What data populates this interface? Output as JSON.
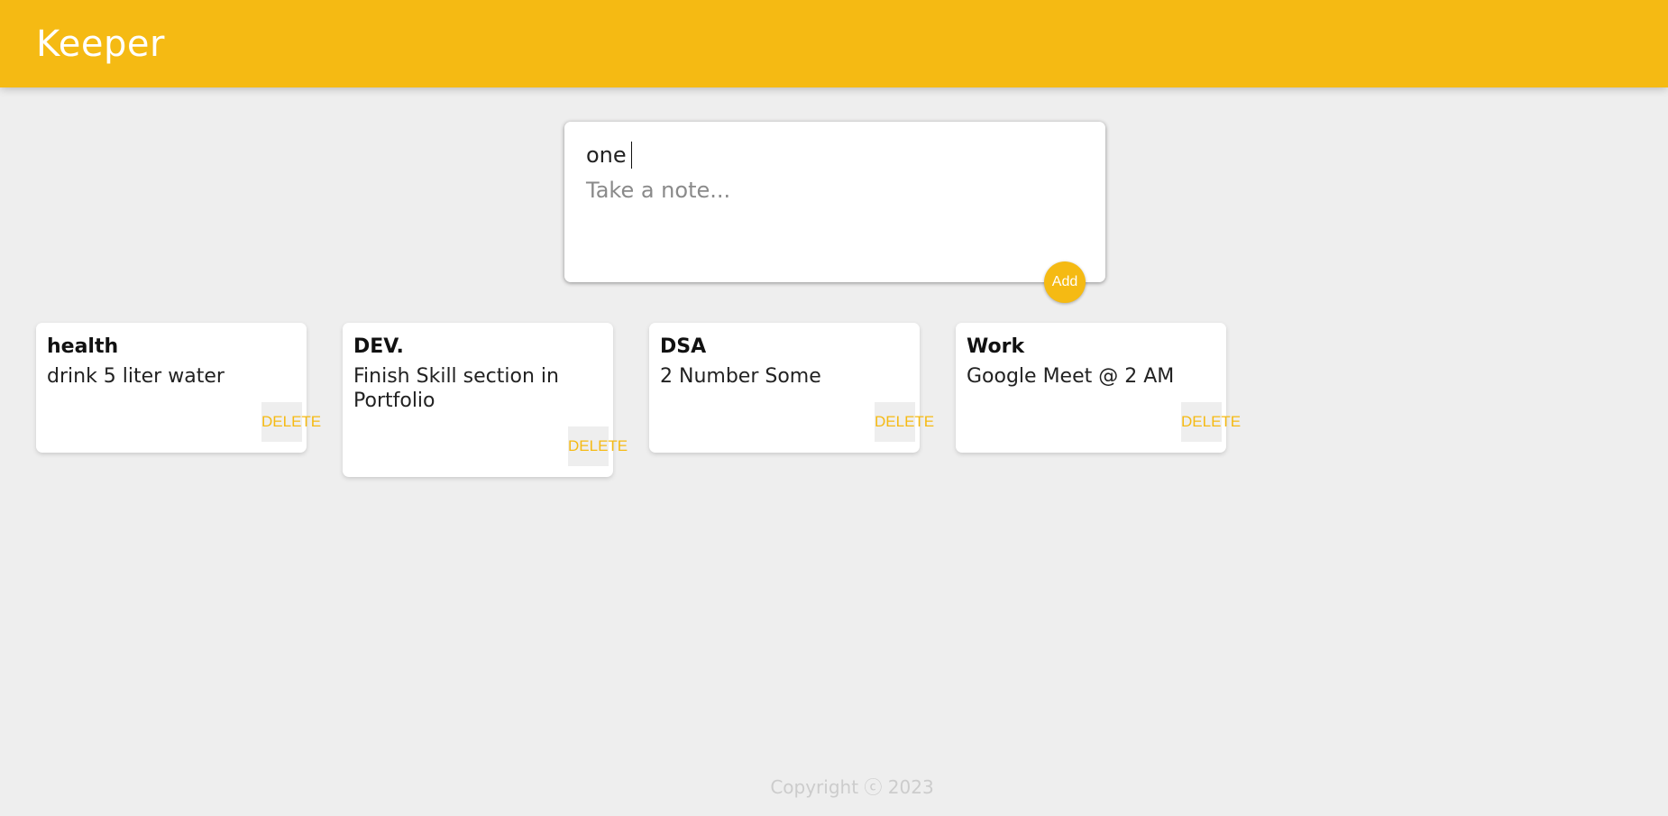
{
  "header": {
    "title": "Keeper"
  },
  "create_note": {
    "title_value": "one",
    "content_placeholder": "Take a note...",
    "add_label": "Add"
  },
  "notes": [
    {
      "title": "health",
      "content": "drink 5 liter water",
      "delete_label": "DELETE"
    },
    {
      "title": "DEV.",
      "content": "Finish Skill section in Portfolio",
      "delete_label": "DELETE"
    },
    {
      "title": "DSA",
      "content": "2 Number Some",
      "delete_label": "DELETE"
    },
    {
      "title": "Work",
      "content": "Google Meet @ 2 AM",
      "delete_label": "DELETE"
    }
  ],
  "footer": {
    "copyright": "Copyright ⓒ 2023"
  },
  "colors": {
    "accent": "#f5ba13",
    "background": "#eeeeee"
  }
}
